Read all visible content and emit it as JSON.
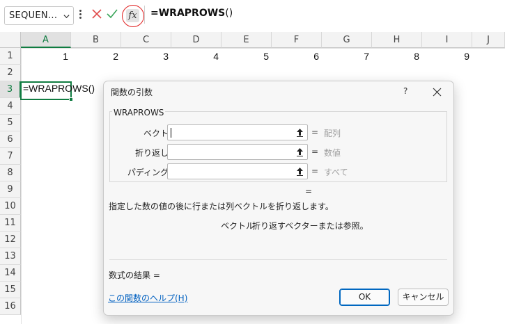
{
  "formula_bar": {
    "name_box": "SEQUEN...",
    "fx_label": "fx",
    "formula": "=WRAPROWS",
    "formula_paren": "()"
  },
  "grid": {
    "columns": [
      "A",
      "B",
      "C",
      "D",
      "E",
      "F",
      "G",
      "H",
      "I",
      "J"
    ],
    "rows": [
      "1",
      "2",
      "3",
      "4",
      "5",
      "6",
      "7",
      "8",
      "9",
      "10",
      "11",
      "12",
      "13",
      "14",
      "15",
      "16"
    ],
    "row1_values": [
      "1",
      "2",
      "3",
      "4",
      "5",
      "6",
      "7",
      "8",
      "9"
    ],
    "active_cell_text": "=WRAPROWS()",
    "selected_column": "A",
    "selected_row": "3"
  },
  "dialog": {
    "title": "関数の引数",
    "help_button": "?",
    "function_name": "WRAPROWS",
    "arguments": [
      {
        "label": "ベクトル",
        "value": "",
        "eq": "=",
        "hint": "配列"
      },
      {
        "label": "折り返し数",
        "value": "",
        "eq": "=",
        "hint": "数値"
      },
      {
        "label": "パディング値",
        "value": "",
        "eq": "=",
        "hint": "すべて"
      }
    ],
    "result_eq": "=",
    "description": "指定した数の値の後に行または列ベクトルを折り返します。",
    "arg_desc_name": "ベクトル",
    "arg_desc_text": "折り返すベクターまたは参照。",
    "formula_result": "数式の結果 =",
    "help_link": "この関数のヘルプ(H)",
    "ok_label": "OK",
    "cancel_label": "キャンセル"
  },
  "colors": {
    "excel_green": "#107c41",
    "highlight_circle": "#e01e1e",
    "link_blue": "#0060c0"
  }
}
